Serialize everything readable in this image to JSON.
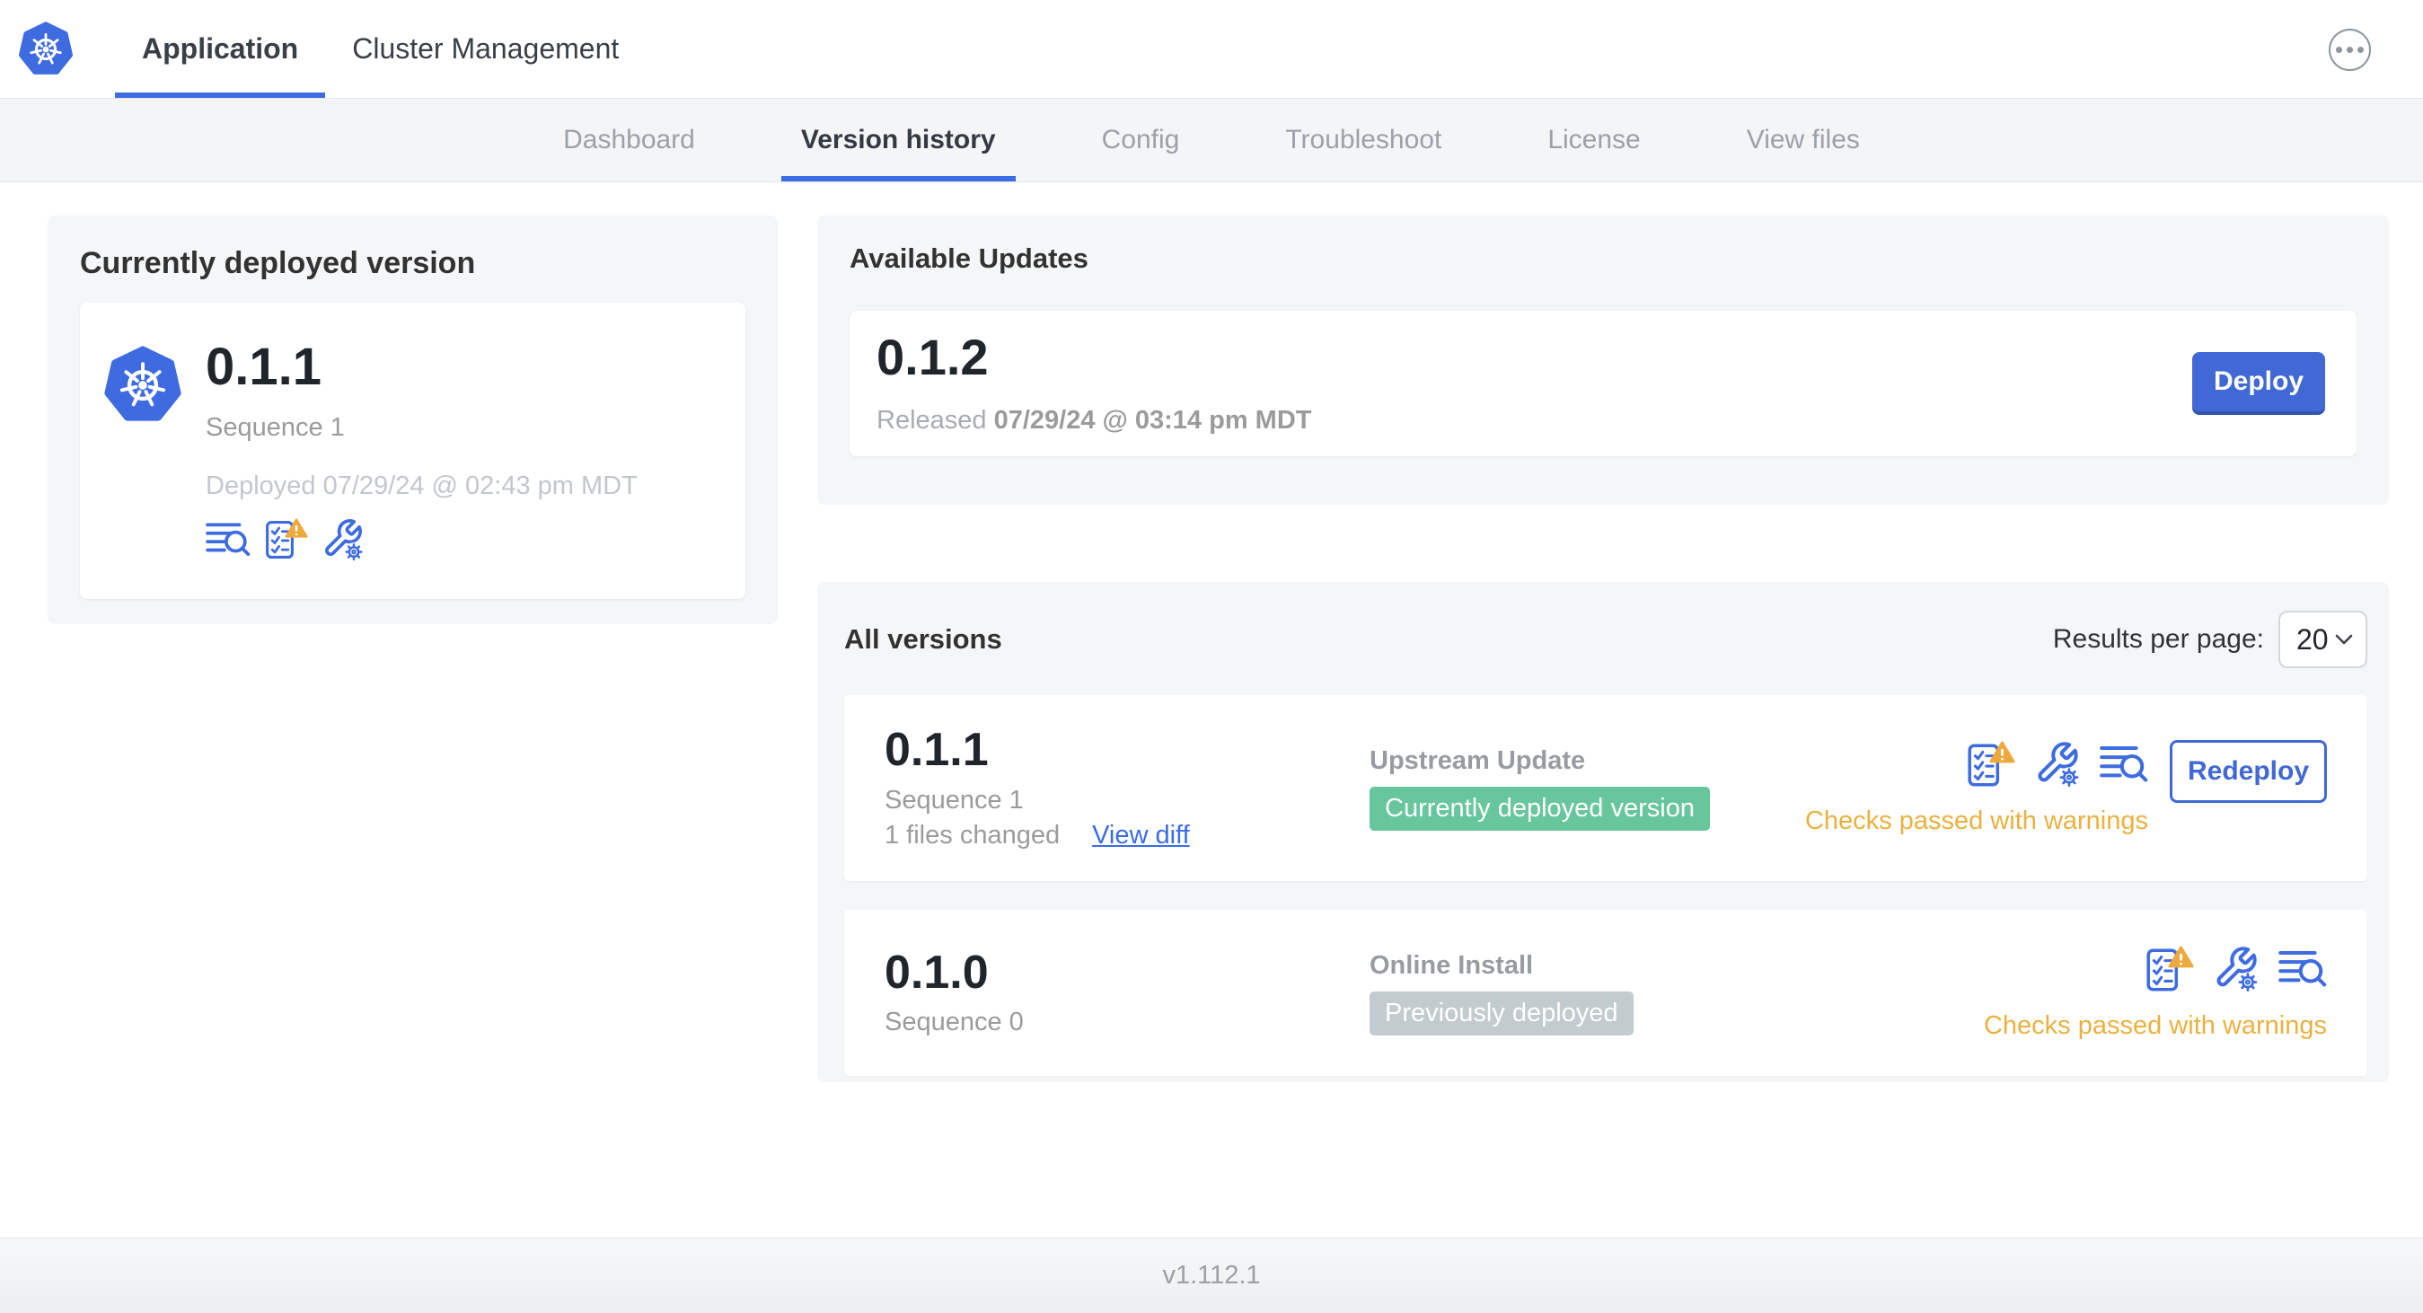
{
  "header": {
    "tabs": [
      {
        "label": "Application",
        "active": true
      },
      {
        "label": "Cluster Management",
        "active": false
      }
    ],
    "more_menu_icon": "ellipsis-icon"
  },
  "subnav": {
    "active": "Version history",
    "items": [
      "Dashboard",
      "Version history",
      "Config",
      "Troubleshoot",
      "License",
      "View files"
    ]
  },
  "current_version": {
    "title": "Currently deployed version",
    "version": "0.1.1",
    "sequence": "Sequence 1",
    "deployed_timestamp": "Deployed 07/29/24 @ 02:43 pm MDT",
    "icons": [
      "deploy-logs-icon",
      "preflight-checks-warning-icon",
      "config-icon"
    ]
  },
  "available_updates": {
    "title": "Available Updates",
    "version": "0.1.2",
    "released_label": "Released",
    "released_timestamp": "07/29/24 @ 03:14 pm MDT",
    "deploy_button": "Deploy"
  },
  "all_versions": {
    "title": "All versions",
    "results_per_page_label": "Results per page:",
    "results_per_page_value": "20",
    "rows": [
      {
        "version": "0.1.1",
        "sequence": "Sequence 1",
        "files_changed": "1 files changed",
        "view_diff_link": "View diff",
        "source": "Upstream Update",
        "status_badge": "Currently deployed version",
        "badge_type": "success",
        "checks_status": "Checks passed with warnings",
        "action_button": "Redeploy",
        "icons": [
          "preflight-checks-warning-icon",
          "config-icon",
          "deploy-logs-icon"
        ]
      },
      {
        "version": "0.1.0",
        "sequence": "Sequence 0",
        "source": "Online Install",
        "status_badge": "Previously deployed",
        "badge_type": "neutral",
        "checks_status": "Checks passed with warnings",
        "icons": [
          "preflight-checks-warning-icon",
          "config-icon",
          "deploy-logs-icon"
        ]
      }
    ]
  },
  "footer": {
    "app_version": "v1.112.1"
  },
  "colors": {
    "primary_blue": "#3B6CE4",
    "button_blue": "#4169D5",
    "kubernetes_blue": "#3E6CE0",
    "warning_amber": "#EBB13F",
    "warning_triangle": "#EEA93C",
    "success_green": "#67C69C",
    "neutral_badge_gray": "#C2CBCE",
    "card_background": "#F5F6F8"
  }
}
